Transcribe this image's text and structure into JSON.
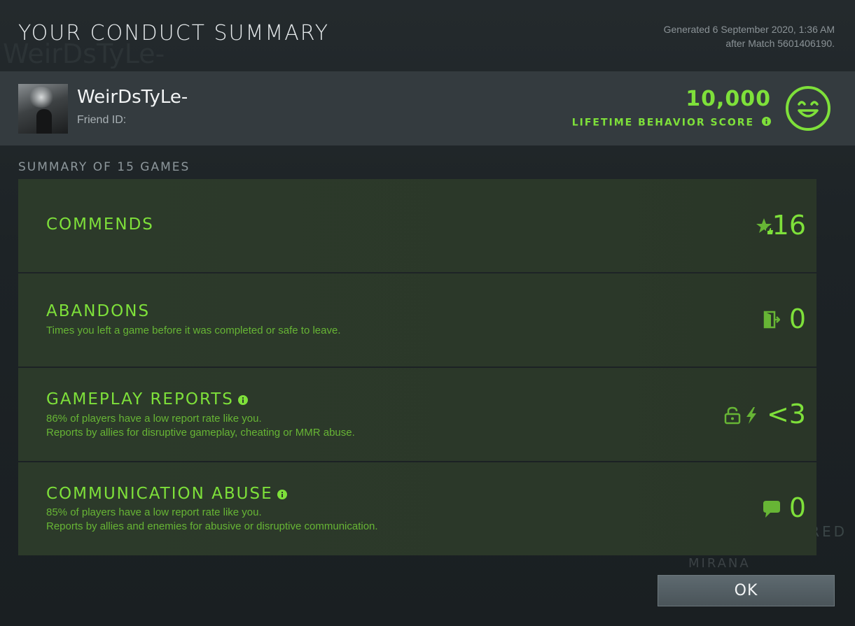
{
  "header": {
    "title": "YOUR CONDUCT SUMMARY",
    "generated_line1": "Generated 6 September 2020, 1:36 AM",
    "generated_line2": "after Match 5601406190."
  },
  "profile": {
    "username": "WeirDsTyLe-",
    "friend_id_label": "Friend ID:"
  },
  "score": {
    "value": "10,000",
    "label": "LIFETIME BEHAVIOR SCORE",
    "icon": "smiley-face-icon",
    "color": "#7ee03a"
  },
  "summary": {
    "label": "SUMMARY OF 15 GAMES"
  },
  "cards": [
    {
      "title": "COMMENDS",
      "value": "16",
      "icon": "star-thumbs-up-icon"
    },
    {
      "title": "ABANDONS",
      "desc1": "Times you left a game before it was completed or safe to leave.",
      "value": "0",
      "icon": "exit-door-icon"
    },
    {
      "title": "GAMEPLAY REPORTS",
      "desc1": "86% of players have a low report rate like you.",
      "desc2": "Reports by allies for disruptive gameplay, cheating or MMR abuse.",
      "value": "<3",
      "icon": "lock-lightning-icon"
    },
    {
      "title": "COMMUNICATION ABUSE",
      "desc1": "85% of players have a low report rate like you.",
      "desc2": "Reports by allies and enemies for abusive or disruptive communication.",
      "value": "0",
      "icon": "chat-bubble-icon"
    }
  ],
  "actions": {
    "ok_label": "OK"
  },
  "background": {
    "ghost_name": "WeirDsTyLe-",
    "ghost_featured": "FEATURED I",
    "ghost_hero": "MIRANA"
  }
}
